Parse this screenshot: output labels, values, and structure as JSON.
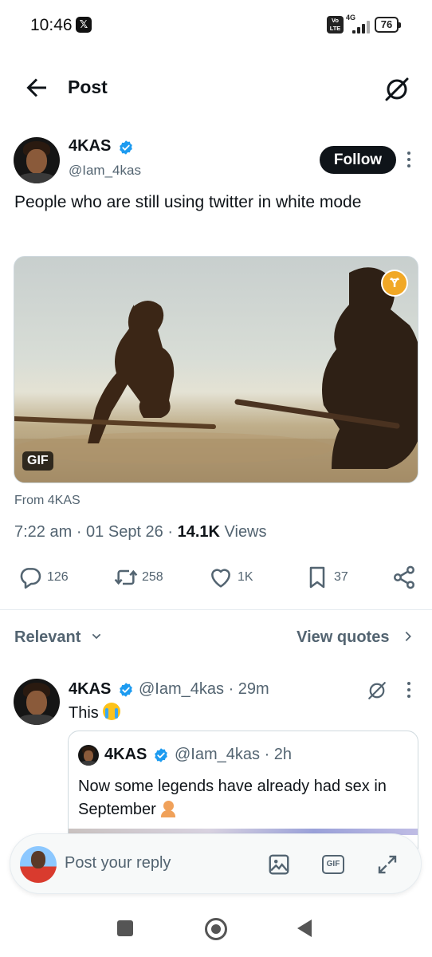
{
  "status_bar": {
    "time": "10:46",
    "notification_icon": "x-app-icon",
    "volte": "Vo\nLTE",
    "network": "4G",
    "battery": "76"
  },
  "header": {
    "title": "Post",
    "back_icon": "arrow-left-icon",
    "grok_icon": "grok-icon"
  },
  "post": {
    "author_name": "4KAS",
    "author_handle": "@Iam_4kas",
    "follow_label": "Follow",
    "text": "People who are still using twitter in white mode",
    "media_badge": "GIF",
    "source": "From 4KAS",
    "time": "7:22 am",
    "date": "01 Sept 26",
    "views_count": "14.1K",
    "views_label": "Views",
    "stats": {
      "replies": "126",
      "reposts": "258",
      "likes": "1K",
      "bookmarks": "37"
    }
  },
  "filter": {
    "relevant_label": "Relevant",
    "view_quotes_label": "View quotes"
  },
  "reply": {
    "author_name": "4KAS",
    "handle_time": "@Iam_4kas · 29m",
    "text": "This"
  },
  "quote": {
    "author_name": "4KAS",
    "handle_time": "@Iam_4kas · 2h",
    "text": "Now some legends have already had sex in September"
  },
  "reply_bar": {
    "placeholder": "Post your reply",
    "gif_label": "GIF"
  },
  "colors": {
    "verified": "#1d9bf0",
    "text_primary": "#0f1419",
    "text_secondary": "#536471",
    "follow_bg": "#0f1419"
  }
}
